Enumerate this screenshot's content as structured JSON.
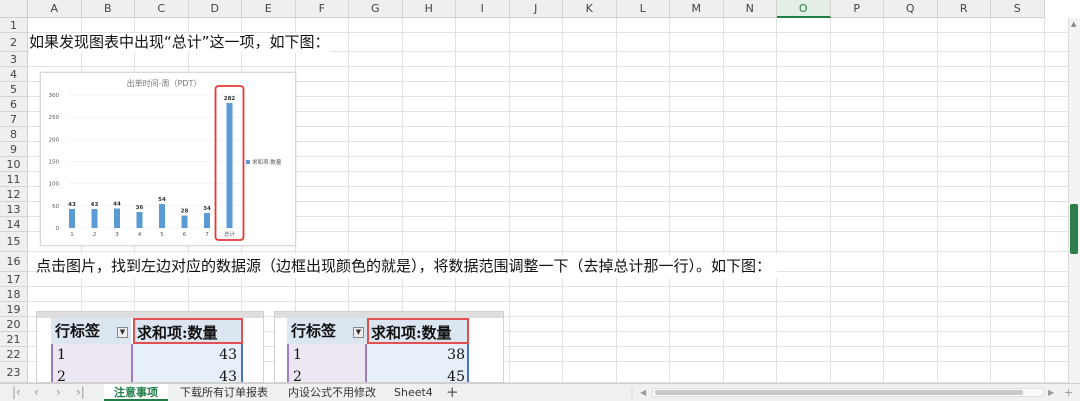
{
  "columns": [
    "A",
    "B",
    "C",
    "D",
    "E",
    "F",
    "G",
    "H",
    "I",
    "J",
    "K",
    "L",
    "M",
    "N",
    "O",
    "P",
    "Q",
    "R",
    "S"
  ],
  "selected_column": "O",
  "rows": [
    "1",
    "2",
    "3",
    "4",
    "5",
    "6",
    "7",
    "8",
    "9",
    "10",
    "11",
    "12",
    "13",
    "14",
    "15",
    "16",
    "17",
    "18",
    "19",
    "20",
    "21",
    "22",
    "23"
  ],
  "cells": {
    "row2_text": "如果发现图表中出现“总计”这一项，如下图：",
    "row16_text": "点击图片，找到左边对应的数据源（边框出现颜色的就是），将数据范围调整一下（去掉总计那一行）。如下图："
  },
  "chart_data": {
    "type": "bar",
    "title": "出单时间-周（PDT）",
    "categories": [
      "1",
      "2",
      "3",
      "4",
      "5",
      "6",
      "7",
      "总计"
    ],
    "values": [
      43,
      43,
      44,
      36,
      54,
      28,
      34,
      282
    ],
    "ylim": [
      0,
      300
    ],
    "yticks": [
      "0",
      "50",
      "100",
      "150",
      "200",
      "250",
      "300"
    ],
    "legend": "求和项:数量",
    "legend_position": "right",
    "bar_color": "#5b9bd5",
    "highlight_color": "#e53935",
    "highlight_category": "总计"
  },
  "pivot_left": {
    "header_label": "行标签",
    "header_value": "求和项:数量",
    "rows": [
      {
        "label": "1",
        "value": "43"
      },
      {
        "label": "2",
        "value": "43"
      }
    ]
  },
  "pivot_right": {
    "header_label": "行标签",
    "header_value": "求和项:数量",
    "rows": [
      {
        "label": "1",
        "value": "38"
      },
      {
        "label": "2",
        "value": "45"
      }
    ]
  },
  "sheet_tabs": [
    {
      "label": "注意事项",
      "active": true
    },
    {
      "label": "下载所有订单报表",
      "active": false
    },
    {
      "label": "内设公式不用修改",
      "active": false
    },
    {
      "label": "Sheet4",
      "active": false
    }
  ],
  "add_sheet_glyph": "+",
  "colors": {
    "accent": "#1e7e45"
  }
}
